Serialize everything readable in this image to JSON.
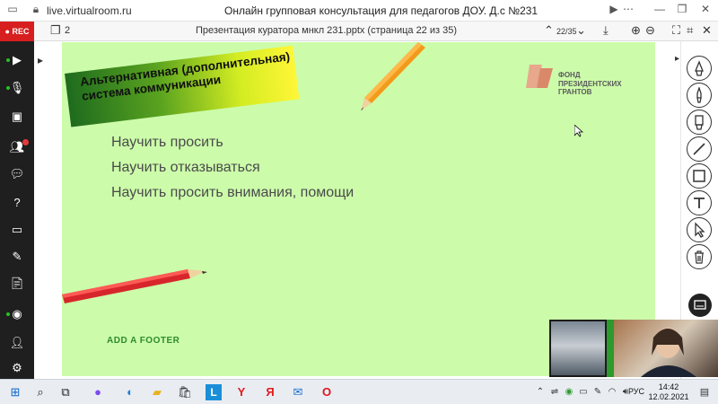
{
  "browser": {
    "url": "live.virtualroom.ru",
    "title": "Онлайн групповая консультация для педагогов ДОУ. Д.с №231"
  },
  "toolbar": {
    "pages_count": "2",
    "document_title": "Презентация куратора мнкл 231.pptx (страница 22 из 35)",
    "page_indicator": "22/35"
  },
  "leftbar": {
    "rec_label": "● REC",
    "participants_badge": "1"
  },
  "slide": {
    "title": "Альтернативная (дополнительная) система коммуникации",
    "bullets": [
      "Научить просить",
      "Научить отказываться",
      "Научить просить внимания, помощи"
    ],
    "footer": "ADD A FOOTER",
    "logo_lines": [
      "ФОНД",
      "ПРЕЗИДЕНТСКИХ",
      "ГРАНТОВ"
    ],
    "colors": {
      "background": "#ccfcaa",
      "footer": "#2f8a2f"
    }
  },
  "taskbar": {
    "language": "РУС",
    "time": "14:42",
    "date": "12.02.2021"
  }
}
